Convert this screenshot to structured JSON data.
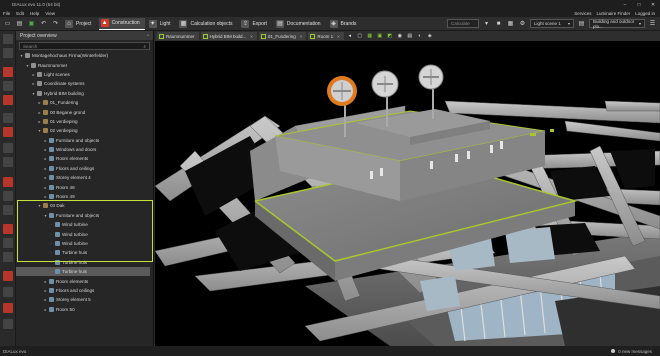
{
  "window": {
    "title": "DIALux evo 11.0 (64 bit)"
  },
  "menu": [
    "File",
    "Edit",
    "Help",
    "View"
  ],
  "menu_right": {
    "services": "Services",
    "luminaire_finder": "Luminaire Finder",
    "logged_in": "Logged in"
  },
  "tabs": [
    {
      "label": "Project",
      "icon": "house-icon",
      "active": false
    },
    {
      "label": "Construction",
      "icon": "construction-icon",
      "active": true
    },
    {
      "label": "Light",
      "icon": "bulb-icon",
      "active": false
    },
    {
      "label": "Calculation objects",
      "icon": "calc-icon",
      "active": false
    },
    {
      "label": "Export",
      "icon": "export-icon",
      "active": false
    },
    {
      "label": "Documentation",
      "icon": "doc-icon",
      "active": false
    },
    {
      "label": "Brands",
      "icon": "brands-icon",
      "active": false
    }
  ],
  "toolbar_right": {
    "calculate": "Calculate",
    "light_scene": "Light scene 1",
    "building_view": "Building and outdoor pla..."
  },
  "panel": {
    "title": "Project overview",
    "search_placeholder": "Search"
  },
  "tree": [
    {
      "label": "Montagehochaus Firma(Winterfelder)",
      "level": 0,
      "state": "open"
    },
    {
      "label": "Raumnummer",
      "level": 1,
      "state": "open"
    },
    {
      "label": "Light scenes",
      "level": 2,
      "state": "closed"
    },
    {
      "label": "Coordinate systems",
      "level": 2,
      "state": "closed"
    },
    {
      "label": "Hybrid BIM building",
      "level": 2,
      "state": "open"
    },
    {
      "label": "01_Fundering",
      "level": 3,
      "state": "closed"
    },
    {
      "label": "00 Begane grond",
      "level": 3,
      "state": "closed"
    },
    {
      "label": "01 verdieping",
      "level": 3,
      "state": "closed"
    },
    {
      "label": "02 verdieping",
      "level": 3,
      "state": "open"
    },
    {
      "label": "Furniture and objects",
      "level": 4,
      "state": "closed"
    },
    {
      "label": "Windows and doors",
      "level": 4,
      "state": "closed"
    },
    {
      "label": "Room elements",
      "level": 4,
      "state": "closed"
    },
    {
      "label": "Floors and ceilings",
      "level": 4,
      "state": "closed"
    },
    {
      "label": "Storey element 4",
      "level": 4,
      "state": "closed"
    },
    {
      "label": "Room 48",
      "level": 4,
      "state": "closed"
    },
    {
      "label": "Room 49",
      "level": 4,
      "state": "closed"
    },
    {
      "label": "03 Dak",
      "level": 3,
      "state": "open"
    },
    {
      "label": "Furniture and objects",
      "level": 4,
      "state": "open"
    },
    {
      "label": "Wind turbine",
      "level": 5,
      "state": "leaf"
    },
    {
      "label": "Wind turbine",
      "level": 5,
      "state": "leaf"
    },
    {
      "label": "Wind turbine",
      "level": 5,
      "state": "leaf"
    },
    {
      "label": "Turbine huis",
      "level": 5,
      "state": "leaf"
    },
    {
      "label": "Turbine huis",
      "level": 5,
      "state": "leaf"
    },
    {
      "label": "Turbine huis",
      "level": 5,
      "state": "leaf",
      "selected": true
    },
    {
      "label": "Room elements",
      "level": 4,
      "state": "closed"
    },
    {
      "label": "Floors and ceilings",
      "level": 4,
      "state": "closed"
    },
    {
      "label": "Storey element 5",
      "level": 4,
      "state": "closed"
    },
    {
      "label": "Room 50",
      "level": 4,
      "state": "closed"
    }
  ],
  "viewport_tabs": [
    "Raumnummer",
    "Hybrid BIM build...",
    "01_Fundering",
    "Room 1"
  ],
  "statusbar": {
    "left": "DIALux evo",
    "messages": "0 new messages"
  },
  "colors": {
    "accent_highlight": "#c6e33a",
    "active_tab_icon": "#d23b2a",
    "selected_turbine": "#f08a24"
  }
}
